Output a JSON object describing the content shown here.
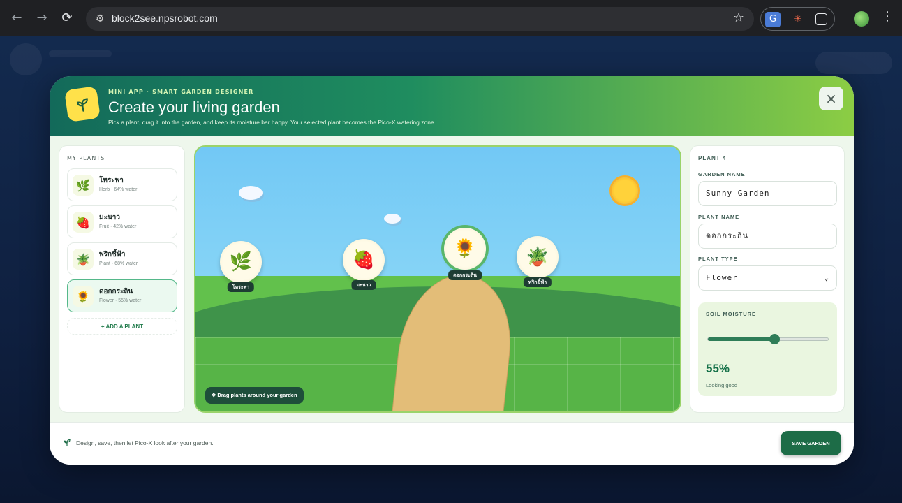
{
  "browser": {
    "url": "block2see.npsrobot.com"
  },
  "header": {
    "eyebrow": "MINI APP · SMART GARDEN DESIGNER",
    "title": "Create your living garden",
    "subtitle": "Pick a plant, drag it into the garden, and keep its moisture bar happy. Your selected plant becomes the Pico-X watering zone.",
    "close_label": "×"
  },
  "plants_panel": {
    "title": "MY PLANTS",
    "items": [
      {
        "name": "โหระพา",
        "meta": "Herb · 64% water",
        "icon": "herb-icon",
        "emoji": "🌿"
      },
      {
        "name": "มะนาว",
        "meta": "Fruit · 42% water",
        "icon": "strawberry-icon",
        "emoji": "🍓"
      },
      {
        "name": "พริกชี้ฟ้า",
        "meta": "Plant · 68% water",
        "icon": "potted-plant-icon",
        "emoji": "🪴"
      },
      {
        "name": "ดอกกระถิน",
        "meta": "Flower · 55% water",
        "icon": "sunflower-icon",
        "emoji": "🌻"
      }
    ],
    "add_label": "+ ADD A PLANT"
  },
  "garden": {
    "pins": [
      {
        "label": "โหระพา",
        "emoji": "🌿"
      },
      {
        "label": "มะนาว",
        "emoji": "🍓"
      },
      {
        "label": "ดอกกระถิน",
        "emoji": "🌻"
      },
      {
        "label": "พริกชี้ฟ้า",
        "emoji": "🪴"
      }
    ],
    "hint": "✥ Drag plants around your garden"
  },
  "details": {
    "heading": "PLANT 4",
    "garden_name_label": "GARDEN NAME",
    "garden_name_value": "Sunny Garden",
    "plant_name_label": "PLANT NAME",
    "plant_name_value": "ดอกกระถิน",
    "plant_type_label": "PLANT TYPE",
    "plant_type_value": "Flower",
    "moisture_label": "SOIL MOISTURE",
    "moisture_value": 0.55,
    "moisture_text": "55%",
    "moisture_status": "Looking good"
  },
  "footer": {
    "note": "Design, save, then let Pico-X look after your garden.",
    "save_label": "SAVE GARDEN"
  },
  "colors": {
    "accent": "#1d6c47",
    "header_start": "#136a5a",
    "header_end": "#8ccd44"
  }
}
